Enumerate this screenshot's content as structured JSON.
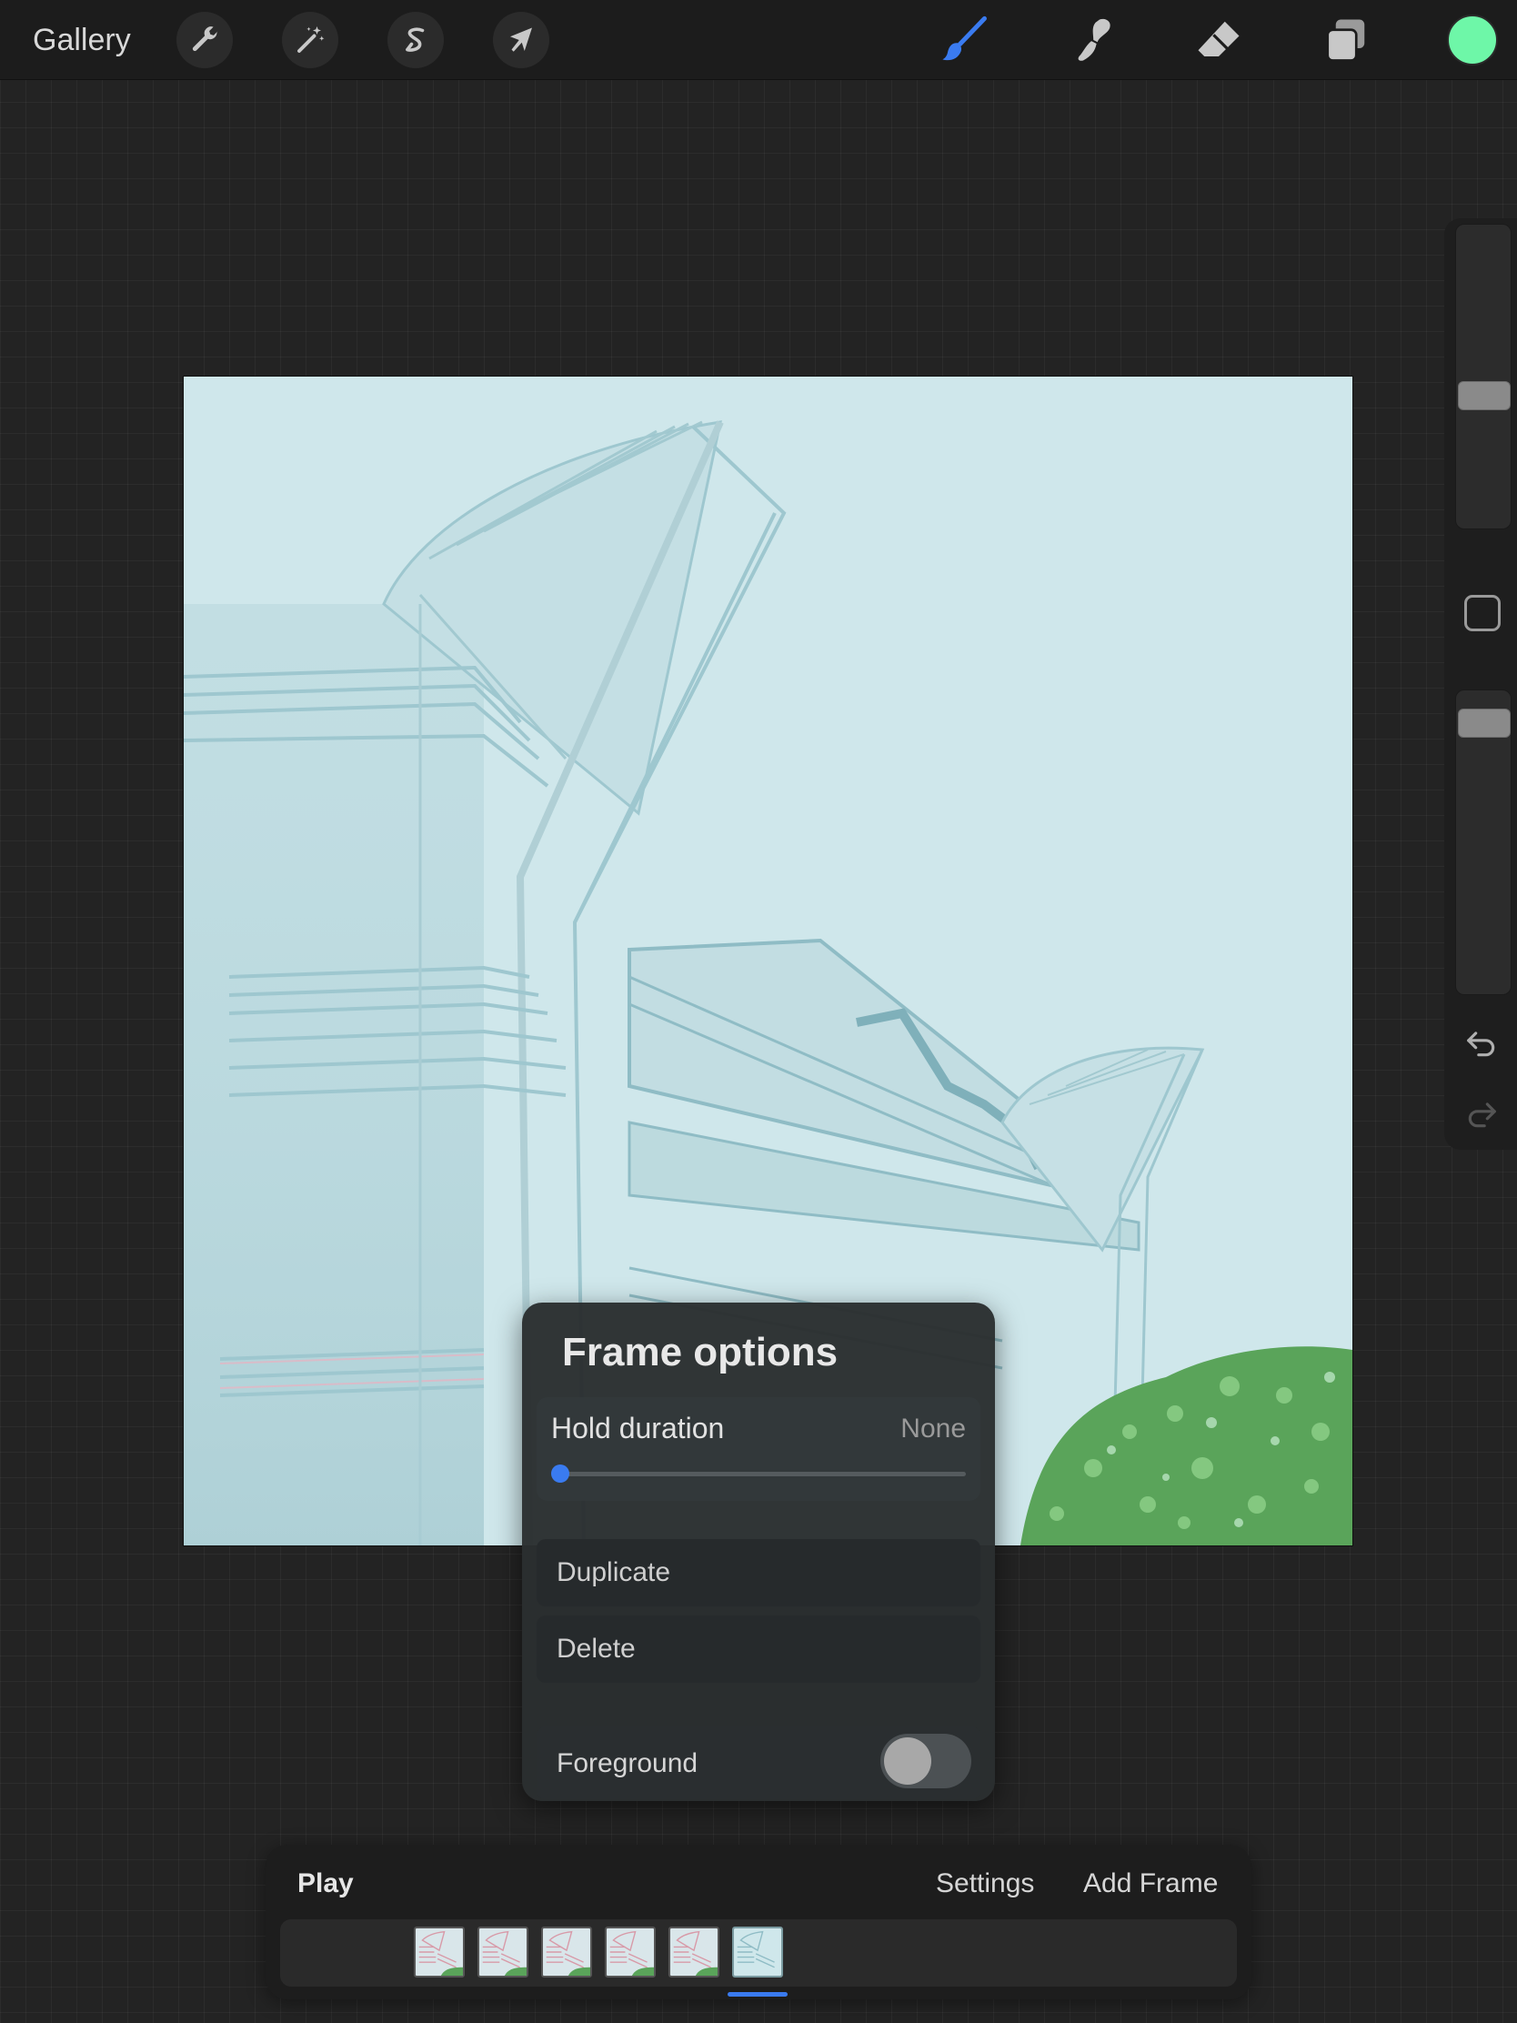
{
  "toolbar": {
    "gallery_label": "Gallery",
    "left_tools": [
      {
        "name": "actions",
        "icon": "wrench-icon"
      },
      {
        "name": "adjustments",
        "icon": "magic-wand-icon"
      },
      {
        "name": "selection",
        "icon": "selection-s-icon"
      },
      {
        "name": "transform",
        "icon": "arrow-cursor-icon"
      }
    ],
    "right_tools": [
      {
        "name": "brush",
        "icon": "brush-icon",
        "active": true
      },
      {
        "name": "smudge",
        "icon": "smudge-icon"
      },
      {
        "name": "eraser",
        "icon": "eraser-icon"
      },
      {
        "name": "layers",
        "icon": "layers-icon"
      }
    ],
    "current_color": "#6ef7a8",
    "active_tool_color": "#3a7bf0"
  },
  "sidebar": {
    "brush_size_level": 0.43,
    "opacity_level": 0.94
  },
  "frame_options": {
    "title": "Frame options",
    "hold_duration_label": "Hold duration",
    "hold_duration_value": "None",
    "hold_duration_level": 0,
    "duplicate_label": "Duplicate",
    "delete_label": "Delete",
    "foreground_label": "Foreground",
    "foreground_on": false
  },
  "timeline": {
    "play_label": "Play",
    "settings_label": "Settings",
    "add_frame_label": "Add Frame",
    "frame_count": 6,
    "selected_frame_index": 5
  }
}
